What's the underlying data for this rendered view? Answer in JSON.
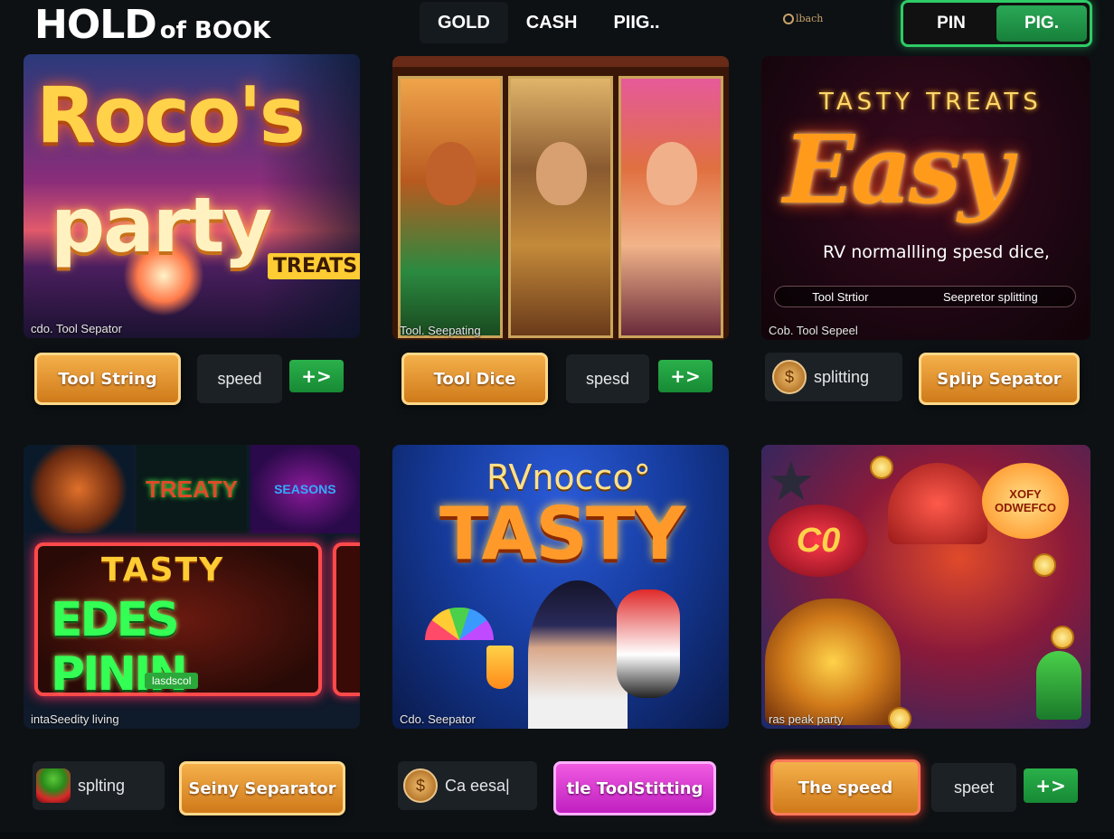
{
  "header": {
    "logo_main": "HOLD",
    "logo_sub": "of BOOK",
    "tabs": [
      {
        "label": "GOLD"
      },
      {
        "label": "CASH"
      },
      {
        "label": "PIIG.."
      }
    ],
    "brand_mini": "lbach",
    "toggle": {
      "left": "PIN",
      "right": "PIG."
    }
  },
  "cards": [
    {
      "art_title_1": "Roco's",
      "art_title_2": "party",
      "art_tag": "TREATS",
      "caption": "cdo. Tool Sepator"
    },
    {
      "caption": "Tool. Seepating"
    },
    {
      "art_title_1": "TASTY TREATS",
      "art_title_2": "Easy",
      "art_subtitle": "RV normallling spesd dice,",
      "bar_left": "Tool Strtior",
      "bar_right": "Seepretor splitting",
      "caption": "Cob. Tool Sepeel"
    },
    {
      "thumb2": "TREATY",
      "thumb3": "SEASONS",
      "board_title_1": "TASTY",
      "board_title_2": "EDES PININ",
      "board_plaque": "lasdscol",
      "caption": "intaSeedity living"
    },
    {
      "art_title_1": "RVnocco°",
      "art_title_2": "TASTY",
      "caption": "Cdo. Seepator"
    },
    {
      "sign": "C0",
      "badge": "XOFY ODWEFCO",
      "caption": "ras peak party"
    }
  ],
  "row1_buttons": {
    "c1_primary": "Tool String",
    "c1_secondary": "speed",
    "c1_go": "+>",
    "c2_primary": "Tool Dice",
    "c2_secondary": "spesd",
    "c2_go": "+>",
    "c3_chip": "splitting",
    "c3_primary": "Splip Sepator"
  },
  "row2_buttons": {
    "c4_chip": "splting",
    "c4_primary": "Seiny Separator",
    "c5_chip": "Ca eesa|",
    "c5_primary": "tle ToolStitting",
    "c6_primary": "The speed",
    "c6_secondary": "speet",
    "c6_go": "+>"
  },
  "colors": {
    "background": "#0d1114",
    "accent_green": "#2ecb66",
    "button_gold": "#e8962e",
    "button_pink": "#d83ad8"
  }
}
